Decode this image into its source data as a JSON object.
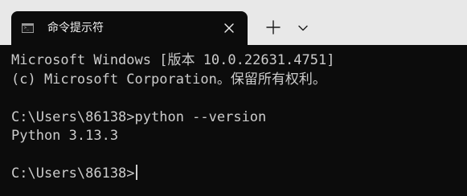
{
  "tab": {
    "title": "命令提示符",
    "icon": "command-prompt-icon",
    "close_icon": "close-icon"
  },
  "toolbar": {
    "new_tab_icon": "plus-icon",
    "dropdown_icon": "chevron-down-icon"
  },
  "terminal": {
    "lines": [
      "Microsoft Windows [版本 10.0.22631.4751]",
      "(c) Microsoft Corporation。保留所有权利。",
      "",
      "C:\\Users\\86138>python --version",
      "Python 3.13.3",
      "",
      "C:\\Users\\86138>"
    ]
  },
  "colors": {
    "background": "#0c0c0c",
    "text": "#cccccc",
    "titlebar": "#e8e8e8",
    "tab_title": "#f2f2f2"
  }
}
